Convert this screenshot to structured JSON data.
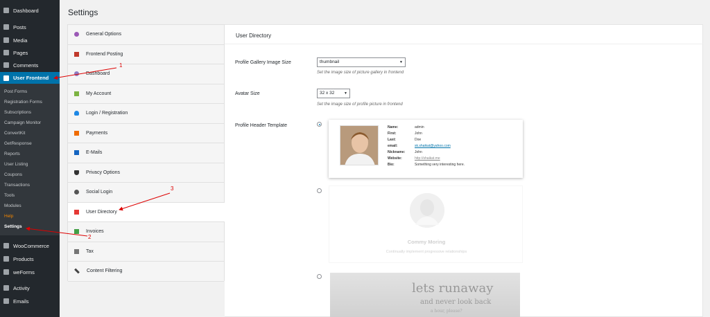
{
  "sidebar": {
    "items": [
      {
        "label": "Dashboard"
      },
      {
        "label": "Posts"
      },
      {
        "label": "Media"
      },
      {
        "label": "Pages"
      },
      {
        "label": "Comments"
      },
      {
        "label": "User Frontend"
      },
      {
        "label": "WooCommerce"
      },
      {
        "label": "Products"
      },
      {
        "label": "weForms"
      },
      {
        "label": "Activity"
      },
      {
        "label": "Emails"
      }
    ],
    "submenu": [
      {
        "label": "Post Forms"
      },
      {
        "label": "Registration Forms"
      },
      {
        "label": "Subscriptions"
      },
      {
        "label": "Campaign Monitor"
      },
      {
        "label": "ConvertKit"
      },
      {
        "label": "GetResponse"
      },
      {
        "label": "Reports"
      },
      {
        "label": "User Listing"
      },
      {
        "label": "Coupons"
      },
      {
        "label": "Transactions"
      },
      {
        "label": "Tools"
      },
      {
        "label": "Modules"
      },
      {
        "label": "Help"
      },
      {
        "label": "Settings"
      }
    ]
  },
  "page": {
    "title": "Settings"
  },
  "tabs": [
    {
      "label": "General Options",
      "icon": "gear-icon"
    },
    {
      "label": "Frontend Posting",
      "icon": "edit-icon"
    },
    {
      "label": "Dashboard",
      "icon": "dashboard-icon"
    },
    {
      "label": "My Account",
      "icon": "account-icon"
    },
    {
      "label": "Login / Registration",
      "icon": "user-icon"
    },
    {
      "label": "Payments",
      "icon": "payment-icon"
    },
    {
      "label": "E-Mails",
      "icon": "email-icon"
    },
    {
      "label": "Privacy Options",
      "icon": "shield-icon"
    },
    {
      "label": "Social Login",
      "icon": "share-icon"
    },
    {
      "label": "User Directory",
      "icon": "directory-icon"
    },
    {
      "label": "Invoices",
      "icon": "invoice-icon"
    },
    {
      "label": "Tax",
      "icon": "tax-icon"
    },
    {
      "label": "Content Filtering",
      "icon": "wrench-icon"
    }
  ],
  "panel": {
    "heading": "User Directory",
    "gallery": {
      "label": "Profile Gallery Image Size",
      "value": "thumbnail",
      "desc": "Set the image size of picture gallery in frontend"
    },
    "avatar": {
      "label": "Avatar Size",
      "value": "32 x 32",
      "desc": "Set the image size of profile picture in frontend"
    },
    "header_template": {
      "label": "Profile Header Template"
    }
  },
  "profile": {
    "labels": [
      "Name:",
      "First:",
      "Last:",
      "email:",
      "Nickname:",
      "Website:",
      "Bio:"
    ],
    "values": [
      "admin",
      "John",
      "Doe",
      "sk.shaikat@yahoo.com",
      "John",
      "http://shaikat.me",
      "Something very interesting here."
    ]
  },
  "template2": {
    "name": "Commy Moring",
    "desc": "Continually implement progressive relationships"
  },
  "template3": {
    "line1": "lets runaway",
    "line2": "and never look back",
    "line3": "a hour, please?"
  },
  "annotations": [
    "1",
    "2",
    "3"
  ],
  "colors": {
    "accent": "#0073aa",
    "sidebar": "#23282d",
    "annotation": "#dd0000"
  }
}
